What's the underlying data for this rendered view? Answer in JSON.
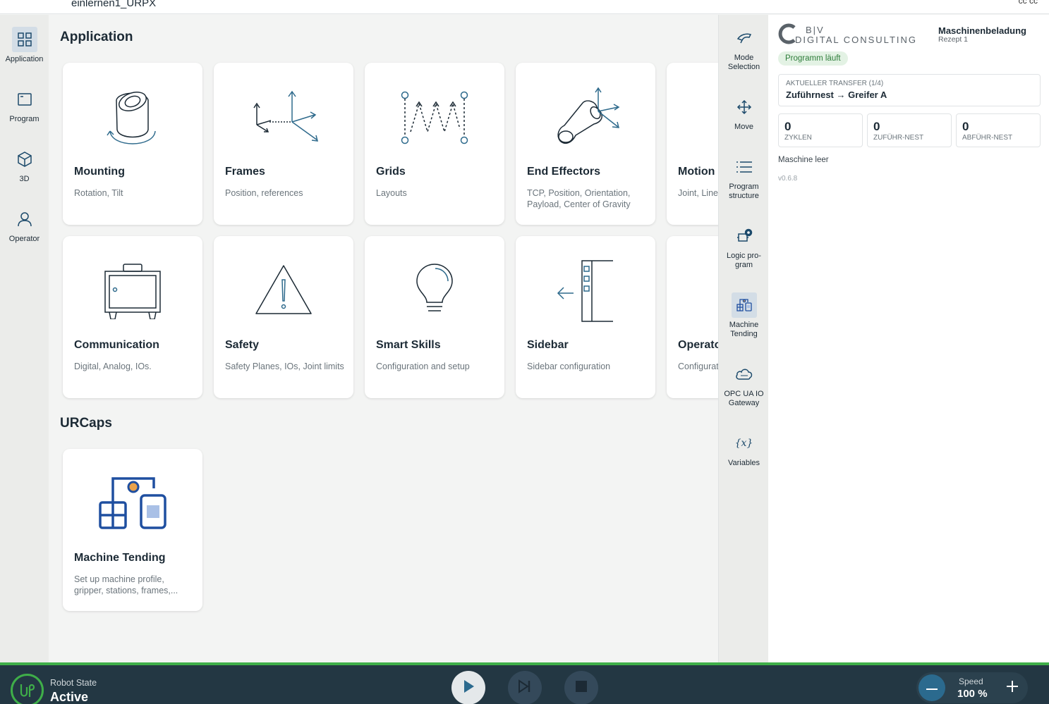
{
  "window": {
    "title": "einlernen1_URPX",
    "right_text": "cc cc"
  },
  "left_nav": [
    {
      "label": "Application",
      "icon": "grid-icon"
    },
    {
      "label": "Program",
      "icon": "program-icon"
    },
    {
      "label": "3D",
      "icon": "cube-icon"
    },
    {
      "label": "Operator",
      "icon": "person-icon"
    }
  ],
  "application": {
    "heading": "Application",
    "cards": [
      {
        "title": "Mounting",
        "subtitle": "Rotation, Tilt"
      },
      {
        "title": "Frames",
        "subtitle": "Position, references"
      },
      {
        "title": "Grids",
        "subtitle": "Layouts"
      },
      {
        "title": "End Effectors",
        "subtitle": "TCP, Position, Orientation, Payload, Center of Gravity"
      },
      {
        "title": "Motion",
        "subtitle": "Joint, Linear"
      },
      {
        "title": "Communication",
        "subtitle": "Digital, Analog, IOs."
      },
      {
        "title": "Safety",
        "subtitle": "Safety Planes, IOs, Joint limits"
      },
      {
        "title": "Smart Skills",
        "subtitle": "Configuration and setup"
      },
      {
        "title": "Sidebar",
        "subtitle": "Sidebar configuration"
      },
      {
        "title": "Operator",
        "subtitle": "Configuration of URCaps"
      }
    ]
  },
  "urcaps": {
    "heading": "URCaps",
    "cards": [
      {
        "title": "Machine Tending",
        "subtitle": "Set up machine profile, gripper, stations, frames,..."
      }
    ]
  },
  "toolbar": [
    {
      "label": "Mode Selection",
      "icon": "mode-icon"
    },
    {
      "label": "Move",
      "icon": "move-arrows-icon"
    },
    {
      "label": "Program structure",
      "icon": "list-icon"
    },
    {
      "label": "Logic pro- gram",
      "icon": "logic-icon"
    },
    {
      "label": "Machine Tending",
      "icon": "machine-tending-icon"
    },
    {
      "label": "OPC UA IO Gateway",
      "icon": "cloud-icon"
    },
    {
      "label": "Variables",
      "icon": "variables-icon"
    }
  ],
  "panel": {
    "logo_line1": "B|V",
    "logo_line2": "DIGITAL CONSULTING",
    "title": "Maschinenbeladung",
    "subtitle": "Rezept 1",
    "badge": "Programm läuft",
    "transfer_label": "AKTUELLER TRANSFER (1/4)",
    "transfer_value": "Zuführnest → Greifer A",
    "stats": [
      {
        "value": "0",
        "label": "ZYKLEN"
      },
      {
        "value": "0",
        "label": "ZUFÜHR-NEST"
      },
      {
        "value": "0",
        "label": "ABFÜHR-NEST"
      }
    ],
    "status": "Maschine leer",
    "version": "v0.6.8"
  },
  "bottom": {
    "robot_state_label": "Robot State",
    "robot_state_value": "Active",
    "speed_label": "Speed",
    "speed_value": "100 %"
  },
  "colors": {
    "accent": "#3fae49",
    "dark": "#233743",
    "icon": "#1c4a6b",
    "blue": "#1f4fa0"
  }
}
